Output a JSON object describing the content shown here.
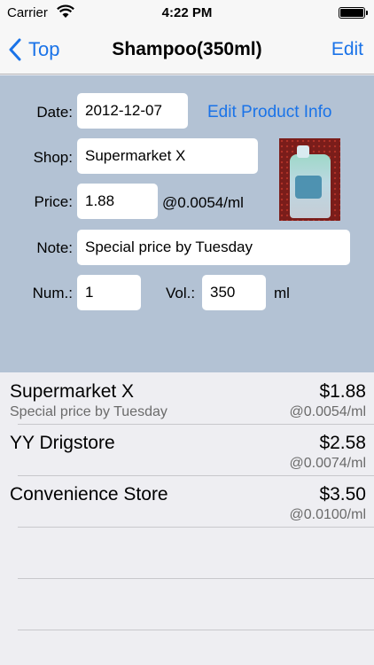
{
  "status_bar": {
    "carrier": "Carrier",
    "time": "4:22 PM"
  },
  "nav": {
    "back_label": "Top",
    "title": "Shampoo(350ml)",
    "edit_label": "Edit"
  },
  "form": {
    "date_label": "Date:",
    "date_value": "2012-12-07",
    "edit_product_link": "Edit Product Info",
    "shop_label": "Shop:",
    "shop_value": "Supermarket X",
    "price_label": "Price:",
    "price_value": "1.88",
    "price_per_ml": "@0.0054/ml",
    "note_label": "Note:",
    "note_value": "Special price by Tuesday",
    "num_label": "Num.:",
    "num_value": "1",
    "vol_label": "Vol.:",
    "vol_value": "350",
    "vol_unit": "ml"
  },
  "purchases": [
    {
      "shop": "Supermarket X",
      "note": "Special price by Tuesday",
      "price": "$1.88",
      "unit_price": "@0.0054/ml"
    },
    {
      "shop": "YY Drigstore",
      "note": "",
      "price": "$2.58",
      "unit_price": "@0.0074/ml"
    },
    {
      "shop": "Convenience Store",
      "note": "",
      "price": "$3.50",
      "unit_price": "@0.0100/ml"
    }
  ],
  "colors": {
    "accent": "#1a73e8",
    "form_background": "#b3c2d4",
    "list_background": "#eeeef2"
  }
}
